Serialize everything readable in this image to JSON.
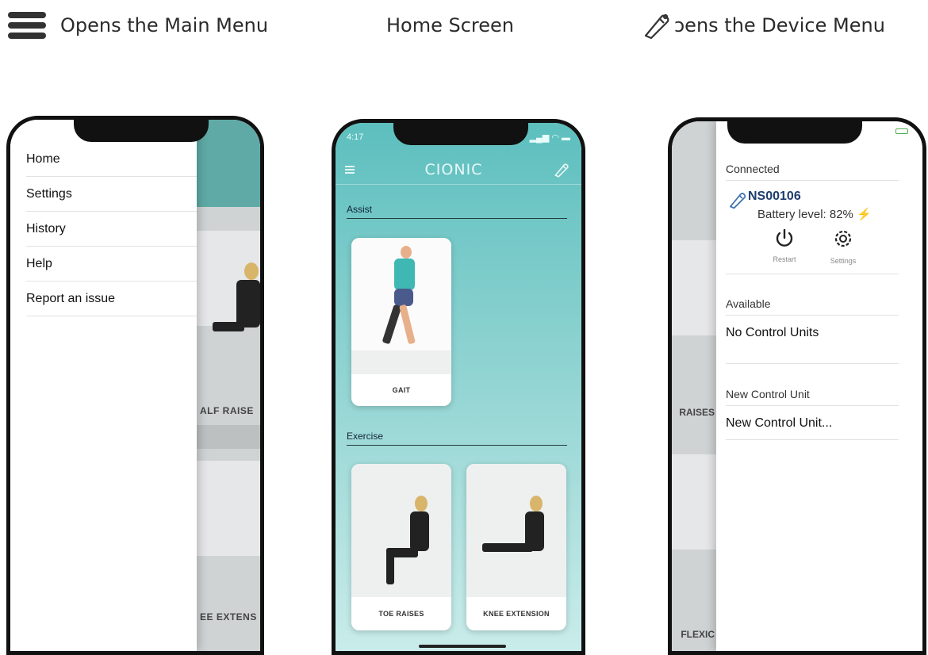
{
  "captions": {
    "left": "Opens the Main Menu",
    "middle": "Home Screen",
    "right": "ɔens the Device Menu"
  },
  "phone1": {
    "menu": [
      "Home",
      "Settings",
      "History",
      "Help",
      "Report an issue"
    ],
    "background_labels": [
      "ALF RAISE",
      "EE EXTENS"
    ]
  },
  "phone2": {
    "status_time": "4:17",
    "logo": "CIONIC",
    "sections": [
      "Assist",
      "Exercise"
    ],
    "cards": [
      "GAIT",
      "TOE RAISES",
      "KNEE EXTENSION"
    ]
  },
  "phone3": {
    "connected_title": "Connected",
    "device_name": "NS00106",
    "battery_label": "Battery level: 82%",
    "bolt": "⚡",
    "actions": [
      "Restart",
      "Settings"
    ],
    "available_title": "Available",
    "available_text": "No Control Units",
    "new_title": "New Control Unit",
    "new_text": "New Control Unit...",
    "background_labels": [
      "RAISES",
      "FLEXIC"
    ]
  },
  "colors": {
    "teal": "#5dbfbe",
    "device_name": "#1e3d6e",
    "battery_green": "#4caf50",
    "bolt": "#f2b43a"
  },
  "icons": [
    "hamburger-menu-icon",
    "pen-device-icon",
    "restart-icon",
    "settings-gear-icon"
  ]
}
